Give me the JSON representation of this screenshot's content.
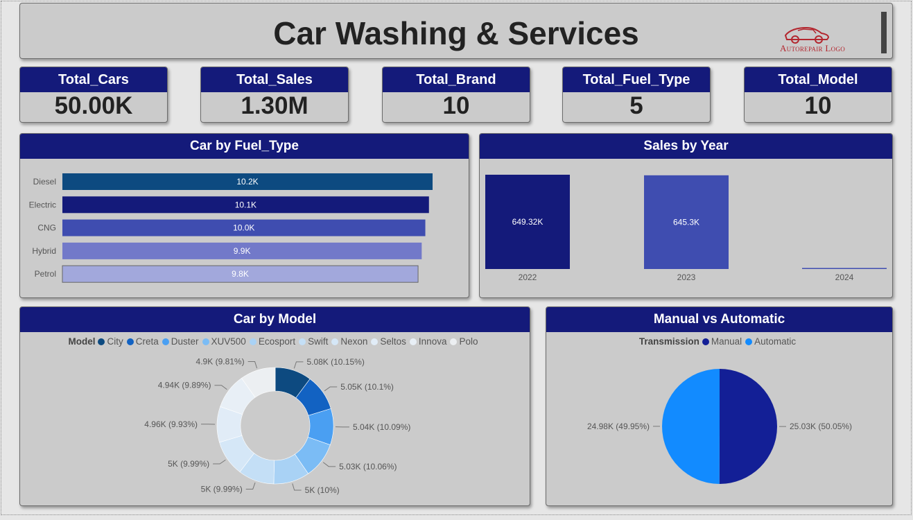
{
  "header": {
    "title": "Car Washing & Services",
    "logo_text": "Autorepair Logo"
  },
  "kpis": [
    {
      "label": "Total_Cars",
      "value": "50.00K"
    },
    {
      "label": "Total_Sales",
      "value": "1.30M"
    },
    {
      "label": "Total_Brand",
      "value": "10"
    },
    {
      "label": "Total_Fuel_Type",
      "value": "5"
    },
    {
      "label": "Total_Model",
      "value": "10"
    }
  ],
  "chart_data": [
    {
      "type": "bar",
      "orientation": "horizontal",
      "title": "Car by Fuel_Type",
      "categories": [
        "Diesel",
        "Electric",
        "CNG",
        "Hybrid",
        "Petrol"
      ],
      "values": [
        10200,
        10100,
        10000,
        9900,
        9800
      ],
      "labels": [
        "10.2K",
        "10.1K",
        "10.0K",
        "9.9K",
        "9.8K"
      ],
      "colors": [
        "#0d4a80",
        "#141a7a",
        "#3f4db0",
        "#7279c9",
        "#a2a8dc"
      ]
    },
    {
      "type": "bar",
      "title": "Sales by Year",
      "categories": [
        "2022",
        "2023",
        "2024"
      ],
      "values": [
        649320,
        645300,
        2000
      ],
      "labels": [
        "649.32K",
        "645.3K",
        ""
      ],
      "colors": [
        "#141a7a",
        "#3f4db0",
        "#3f4db0"
      ]
    },
    {
      "type": "pie",
      "donut": true,
      "title": "Car by Model",
      "legend_title": "Model",
      "categories": [
        "City",
        "Creta",
        "Duster",
        "XUV500",
        "Ecosport",
        "Swift",
        "Nexon",
        "Seltos",
        "Innova",
        "Polo"
      ],
      "values": [
        5080,
        5050,
        5040,
        5030,
        5000,
        5000,
        5000,
        4960,
        4940,
        4900
      ],
      "labels": [
        "5.08K (10.15%)",
        "5.05K (10.1%)",
        "5.04K (10.09%)",
        "5.03K (10.06%)",
        "5K (10%)",
        "5K (9.99%)",
        "5K (9.99%)",
        "4.96K (9.93%)",
        "4.94K (9.89%)",
        "4.9K (9.81%)"
      ],
      "colors": [
        "#0d4a80",
        "#1262c2",
        "#4a9ff2",
        "#7bbcf5",
        "#a9d2f5",
        "#c4dff6",
        "#d5e7f7",
        "#e1ecf7",
        "#e8eff6",
        "#eceff2"
      ]
    },
    {
      "type": "pie",
      "title": "Manual vs Automatic",
      "legend_title": "Transmission",
      "categories": [
        "Manual",
        "Automatic"
      ],
      "values": [
        25030,
        24980
      ],
      "labels": [
        "25.03K (50.05%)",
        "24.98K (49.95%)"
      ],
      "colors": [
        "#131f96",
        "#128bff"
      ]
    }
  ]
}
